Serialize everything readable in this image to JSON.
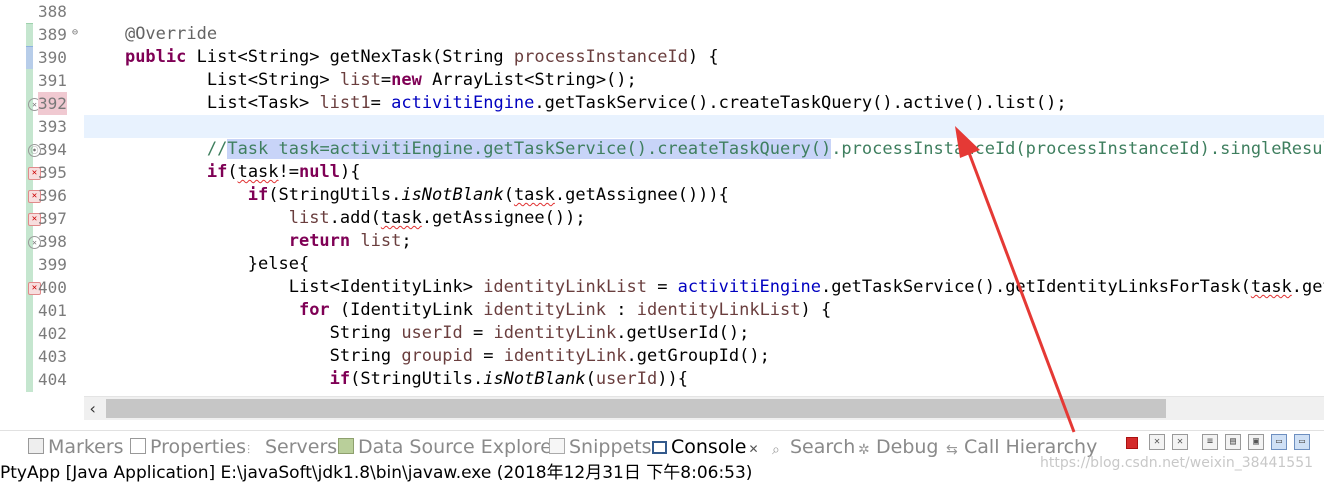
{
  "editor": {
    "line_numbers": [
      "388",
      "389",
      "390",
      "391",
      "392",
      "393",
      "394",
      "395",
      "396",
      "397",
      "398",
      "399",
      "400",
      "401",
      "402",
      "403",
      "404"
    ],
    "lines": {
      "l389": {
        "annotation": "@Override"
      },
      "l390": {
        "kw_public": "public",
        "type": " List<String> ",
        "method": "getNexTask(String ",
        "param": "processInstanceId",
        "end": ") {"
      },
      "l391": {
        "indent": "        ",
        "type": "List<String> ",
        "var": "list",
        "eq": "=",
        "kw_new": "new",
        "rest": " ArrayList<String>();"
      },
      "l392": {
        "indent": "        ",
        "type": "List<Task> ",
        "var": "list1",
        "eq": "= ",
        "field": "activitiEngine",
        "rest": ".getTaskService().createTaskQuery().active().list();"
      },
      "l394": {
        "indent": "        ",
        "slashes": "//",
        "selected": "Task task=activitiEngine.getTaskService().createTaskQuery()",
        "rest": ".processInstanceId(processInstanceId).singleResult();"
      },
      "l395": {
        "indent": "        ",
        "kw_if": "if",
        "p1": "(",
        "task": "task",
        "p2": "!=",
        "kw_null": "null",
        "p3": "){"
      },
      "l396": {
        "indent": "            ",
        "kw_if": "if",
        "p1": "(StringUtils.",
        "static_call": "isNotBlank",
        "p2": "(",
        "task": "task",
        "p3": ".getAssignee())){"
      },
      "l397": {
        "indent": "                ",
        "var": "list",
        "p1": ".add(",
        "task": "task",
        "p2": ".getAssignee());"
      },
      "l398": {
        "indent": "                ",
        "kw_return": "return",
        "sp": " ",
        "var": "list",
        "end": ";"
      },
      "l399": {
        "indent": "            ",
        "text": "}else{"
      },
      "l400": {
        "indent": "                ",
        "type": "List<IdentityLink> ",
        "var": "identityLinkList",
        "eq": " = ",
        "field": "activitiEngine",
        "p1": ".getTaskService().getIdentityLinksForTask(",
        "task": "task",
        "p2": ".getId());"
      },
      "l401": {
        "indent": "                 ",
        "kw_for": "for",
        "p1": " (IdentityLink ",
        "var": "identityLink",
        "p2": " : ",
        "var2": "identityLinkList",
        "p3": ") {"
      },
      "l402": {
        "indent": "                    ",
        "type": "String ",
        "var": "userId",
        "eq": " = ",
        "var2": "identityLink",
        "rest": ".getUserId();"
      },
      "l403": {
        "indent": "                    ",
        "type": "String ",
        "var": "groupid",
        "eq": " = ",
        "var2": "identityLink",
        "rest": ".getGroupId();"
      },
      "l404": {
        "indent": "                    ",
        "kw_if": "if",
        "p1": "(StringUtils.",
        "static_call": "isNotBlank",
        "p2": "(",
        "var": "userId",
        "p3": ")){"
      }
    }
  },
  "panel_tabs": [
    {
      "label": "Markers",
      "active": false
    },
    {
      "label": "Properties",
      "active": false
    },
    {
      "label": "Servers",
      "active": false
    },
    {
      "label": "Data Source Explorer",
      "active": false
    },
    {
      "label": "Snippets",
      "active": false
    },
    {
      "label": "Console",
      "active": true,
      "close": "✕"
    },
    {
      "label": "Search",
      "active": false
    },
    {
      "label": "Debug",
      "active": false
    },
    {
      "label": "Call Hierarchy",
      "active": false
    }
  ],
  "console_status": "PtyApp [Java Application] E:\\javaSoft\\jdk1.8\\bin\\javaw.exe (2018年12月31日 下午8:06:53)",
  "watermark": "https://blog.csdn.net/weixin_38441551",
  "colors": {
    "keyword": "#7f0055",
    "field": "#0000c0",
    "comment": "#3f7f5f",
    "local_var": "#6a3e3e",
    "annotation_arrow": "#e53935"
  },
  "icons": [
    "markers-icon",
    "properties-icon",
    "servers-icon",
    "data-source-explorer-icon",
    "snippets-icon",
    "console-icon",
    "search-icon",
    "debug-icon",
    "call-hierarchy-icon",
    "terminate-icon",
    "remove-launch-icon",
    "remove-all-icon",
    "scroll-lock-icon",
    "pin-console-icon",
    "display-console-icon",
    "open-console-icon"
  ]
}
